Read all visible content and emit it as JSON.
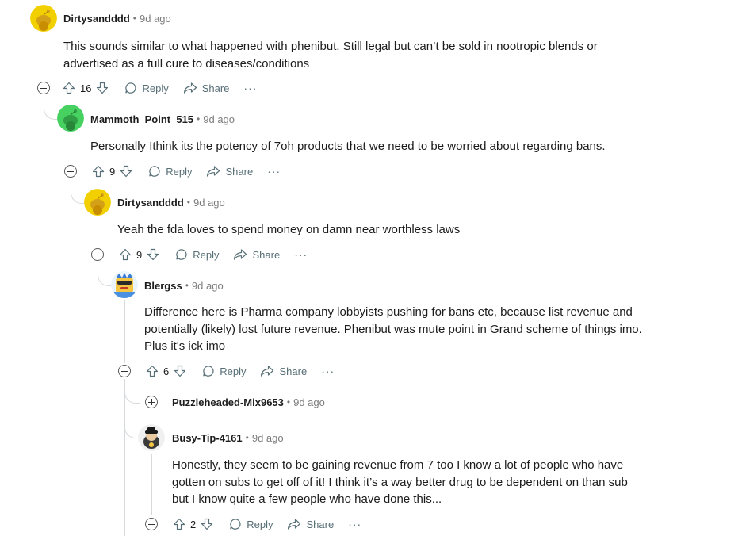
{
  "comments": [
    {
      "author": "Dirtysandddd",
      "time": "9d ago",
      "text_lines": [
        "This sounds similar to what happened with phenibut. Still legal but can’t be sold in nootropic blends or",
        "advertised as a full cure to diseases/conditions"
      ],
      "votes": "16",
      "reply_label": "Reply",
      "share_label": "Share",
      "more_label": "···",
      "avatar_color": "#f2d000"
    },
    {
      "author": "Mammoth_Point_515",
      "time": "9d ago",
      "text_lines": [
        "Personally Ithink its the potency of 7oh products that we need to be worried about regarding bans."
      ],
      "votes": "9",
      "reply_label": "Reply",
      "share_label": "Share",
      "more_label": "···",
      "avatar_color": "#46d160"
    },
    {
      "author": "Dirtysandddd",
      "time": "9d ago",
      "text_lines": [
        "Yeah the fda loves to spend money on damn near worthless laws"
      ],
      "votes": "9",
      "reply_label": "Reply",
      "share_label": "Share",
      "more_label": "···",
      "avatar_color": "#f2d000"
    },
    {
      "author": "Blergss",
      "time": "9d ago",
      "text_lines": [
        "Difference here is Pharma company lobbyists pushing for bans etc, because list revenue and",
        "potentially (likely) lost future revenue. Phenibut was mute point in Grand scheme of things imo.",
        "Plus it's ick imo"
      ],
      "votes": "6",
      "reply_label": "Reply",
      "share_label": "Share",
      "more_label": "···",
      "avatar_color": "#7ec8e3"
    },
    {
      "author": "Puzzleheaded-Mix9653",
      "time": "9d ago",
      "collapsed": true
    },
    {
      "author": "Busy-Tip-4161",
      "time": "9d ago",
      "text_lines": [
        "Honestly, they seem to be gaining revenue from 7 too I know a lot of people who have",
        "gotten on subs to get off of it! I think it’s a way better drug to be dependent on than sub",
        "but I know quite a few people who have done this..."
      ],
      "votes": "2",
      "reply_label": "Reply",
      "share_label": "Share",
      "more_label": "···",
      "avatar_color": "#dcdcdc"
    }
  ],
  "colors": {
    "thread_line": "#d7dadc",
    "meta_gray": "#7c7c7c",
    "action_gray": "#576f76",
    "text": "#1c1c1c"
  }
}
